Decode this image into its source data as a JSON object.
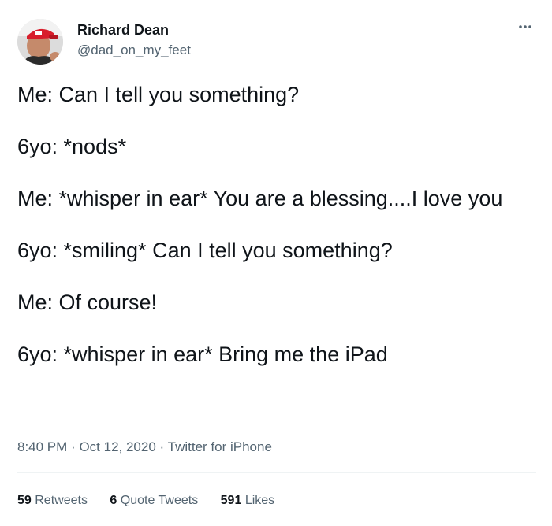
{
  "author": {
    "display_name": "Richard Dean",
    "handle": "@dad_on_my_feet"
  },
  "icons": {
    "more": "more-horizontal-icon",
    "avatar": "profile-photo"
  },
  "tweet": {
    "lines": [
      "Me: Can I tell you something?",
      "6yo: *nods*",
      "Me: *whisper in ear* You are a blessing....I love you",
      "6yo: *smiling* Can I tell you something?",
      "Me: Of course!",
      "6yo: *whisper in ear* Bring me the iPad"
    ]
  },
  "meta": {
    "time": "8:40 PM",
    "separator": "·",
    "date": "Oct 12, 2020",
    "source": "Twitter for iPhone"
  },
  "stats": {
    "retweets_count": "59",
    "retweets_label": "Retweets",
    "quotes_count": "6",
    "quotes_label": "Quote Tweets",
    "likes_count": "591",
    "likes_label": "Likes"
  },
  "colors": {
    "text_primary": "#0f1419",
    "text_secondary": "#536471",
    "divider": "#eff3f4"
  }
}
